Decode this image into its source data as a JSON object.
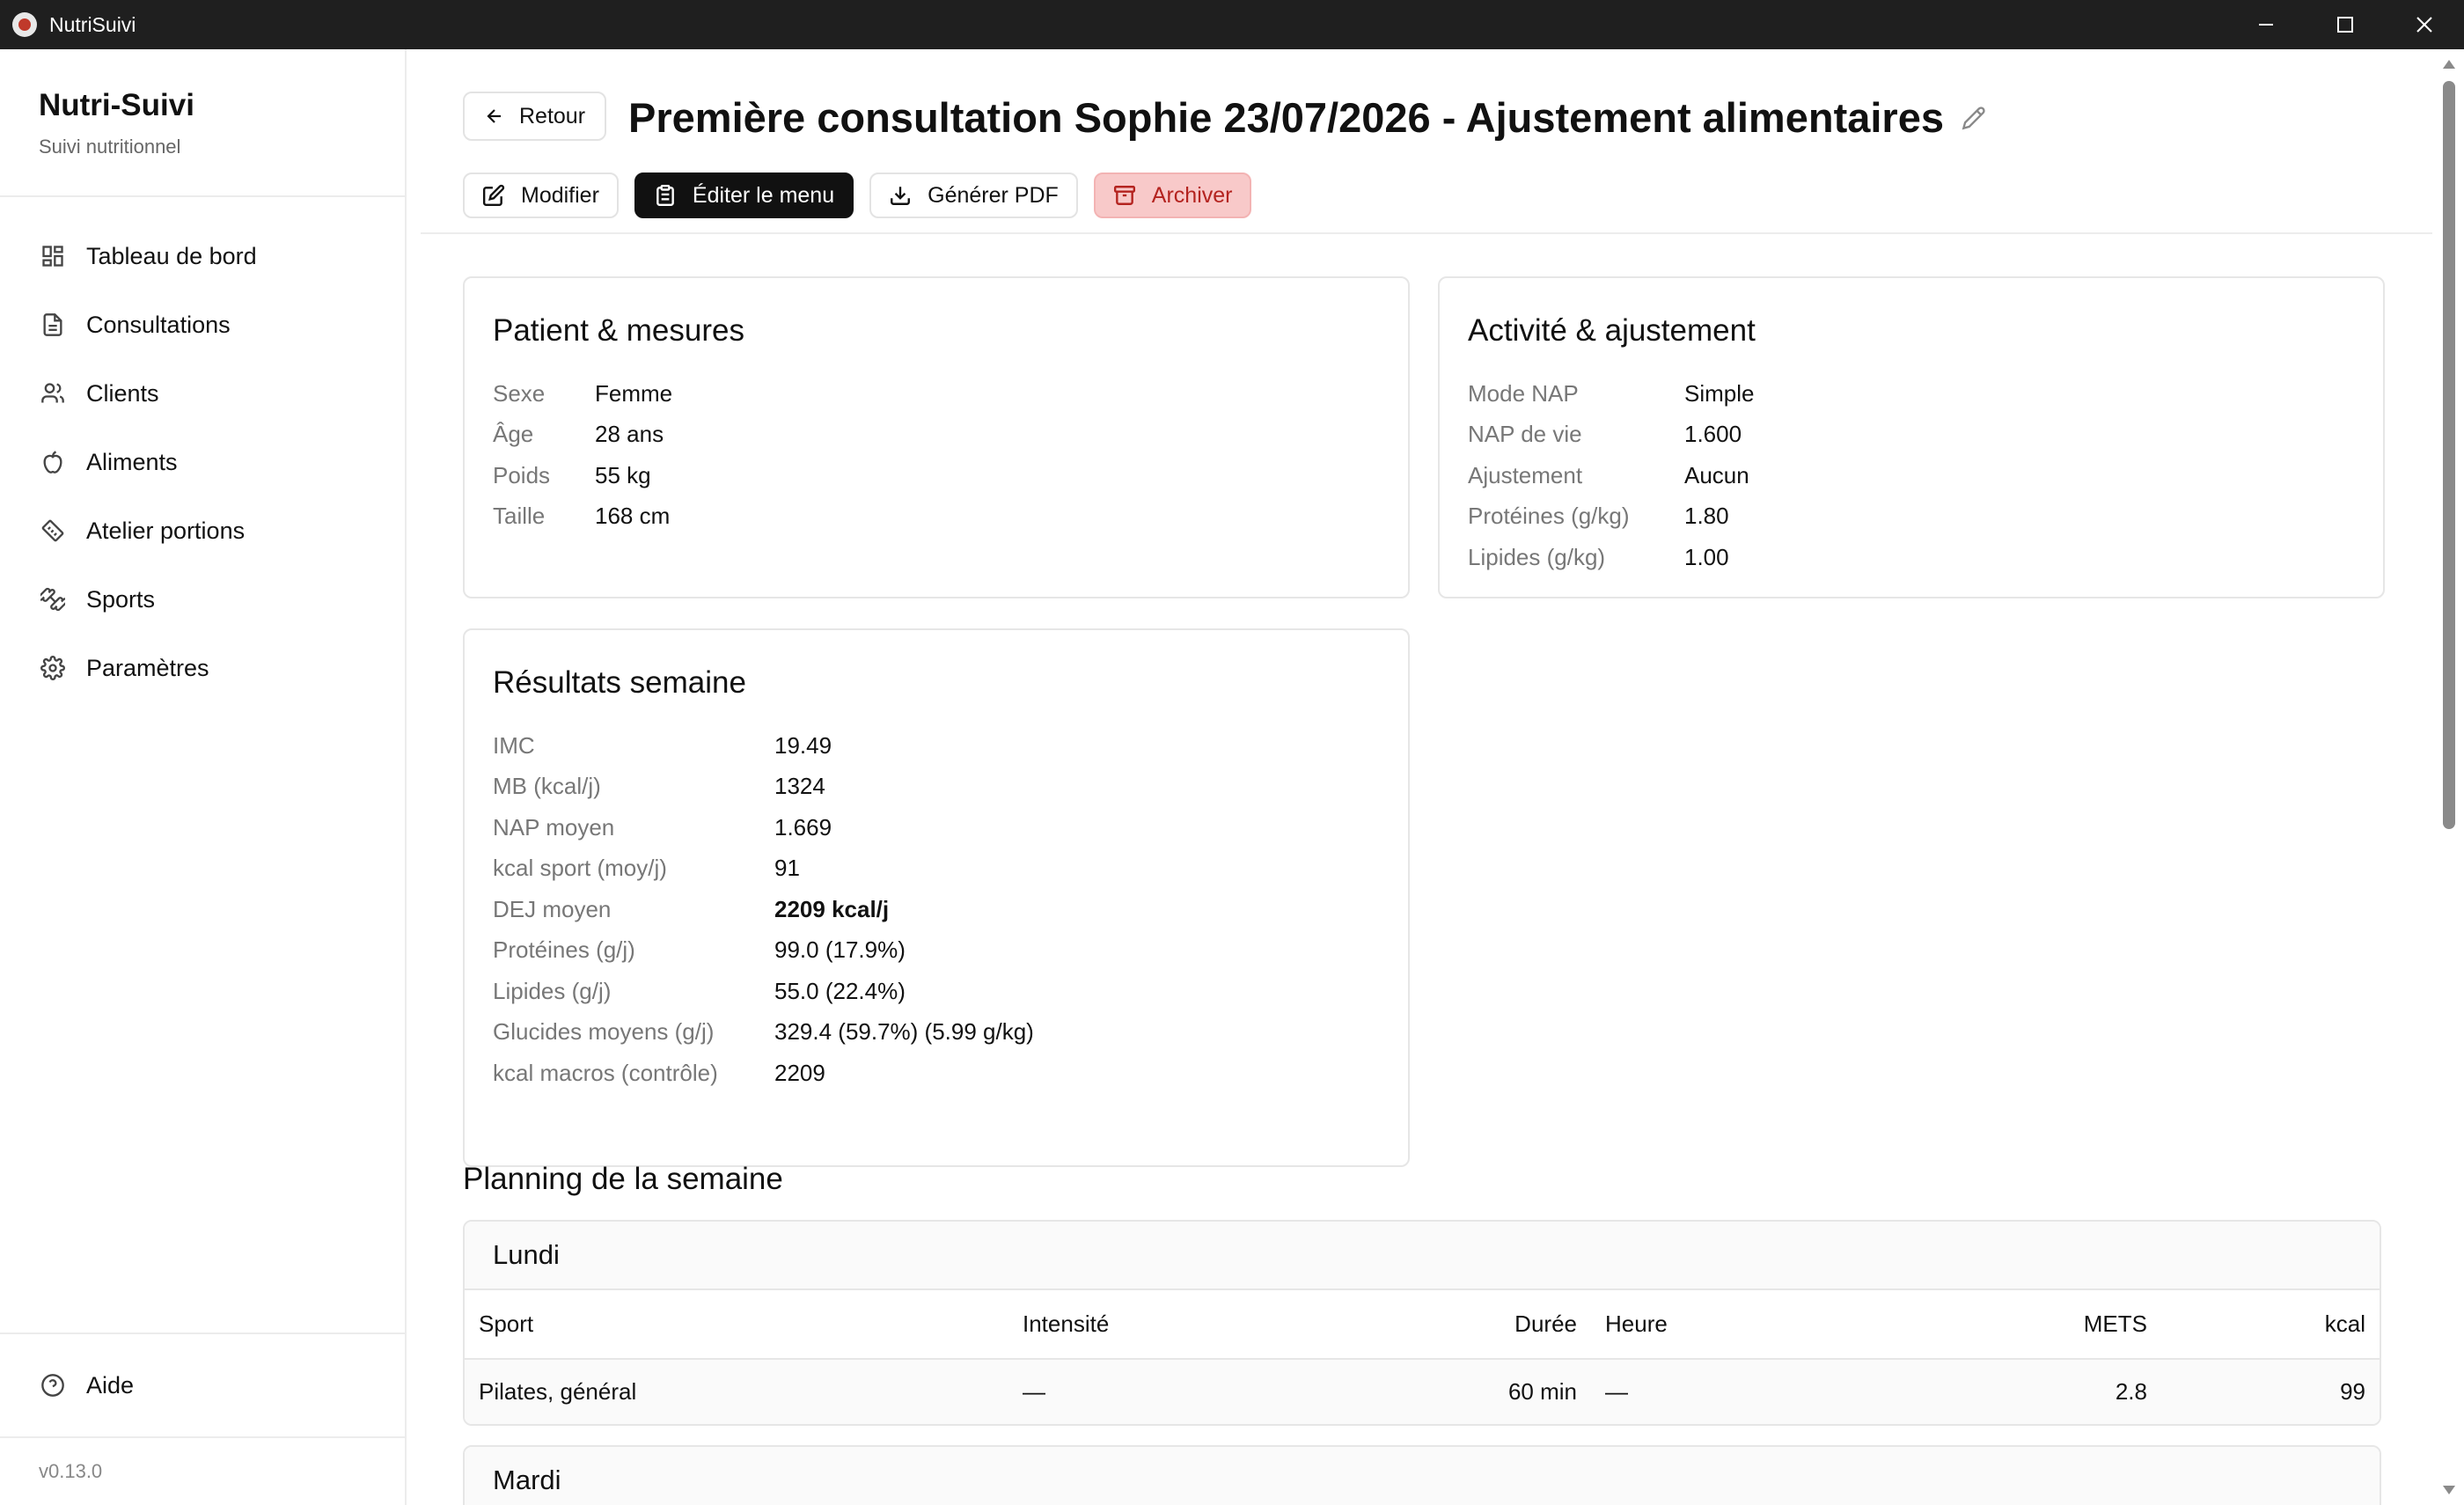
{
  "window": {
    "title": "NutriSuivi",
    "icons": {
      "minimize": "minimize-icon",
      "maximize": "maximize-icon",
      "close": "close-icon"
    }
  },
  "sidebar": {
    "brand_name": "Nutri-Suivi",
    "brand_sub": "Suivi nutritionnel",
    "items": [
      {
        "label": "Tableau de bord",
        "icon": "dashboard-icon"
      },
      {
        "label": "Consultations",
        "icon": "document-icon"
      },
      {
        "label": "Clients",
        "icon": "users-icon"
      },
      {
        "label": "Aliments",
        "icon": "apple-icon"
      },
      {
        "label": "Atelier portions",
        "icon": "ruler-icon"
      },
      {
        "label": "Sports",
        "icon": "dumbbell-icon"
      },
      {
        "label": "Paramètres",
        "icon": "gear-icon"
      }
    ],
    "help_label": "Aide",
    "version": "v0.13.0"
  },
  "header": {
    "back_label": "Retour",
    "title": "Première consultation Sophie 23/07/2026 - Ajustement alimentaires",
    "actions": {
      "edit": "Modifier",
      "edit_menu": "Éditer le menu",
      "pdf": "Générer PDF",
      "archive": "Archiver"
    }
  },
  "patient": {
    "title": "Patient & mesures",
    "rows": [
      {
        "k": "Sexe",
        "v": "Femme"
      },
      {
        "k": "Âge",
        "v": "28 ans"
      },
      {
        "k": "Poids",
        "v": "55 kg"
      },
      {
        "k": "Taille",
        "v": "168 cm"
      }
    ]
  },
  "activity": {
    "title": "Activité & ajustement",
    "rows": [
      {
        "k": "Mode NAP",
        "v": "Simple"
      },
      {
        "k": "NAP de vie",
        "v": "1.600"
      },
      {
        "k": "Ajustement",
        "v": "Aucun"
      },
      {
        "k": "Protéines (g/kg)",
        "v": "1.80"
      },
      {
        "k": "Lipides (g/kg)",
        "v": "1.00"
      }
    ]
  },
  "results": {
    "title": "Résultats semaine",
    "rows": [
      {
        "k": "IMC",
        "v": "19.49"
      },
      {
        "k": "MB (kcal/j)",
        "v": "1324"
      },
      {
        "k": "NAP moyen",
        "v": "1.669"
      },
      {
        "k": "kcal sport (moy/j)",
        "v": "91"
      },
      {
        "k": "DEJ moyen",
        "v": "2209 kcal/j"
      },
      {
        "k": "Protéines (g/j)",
        "v": "99.0 (17.9%)"
      },
      {
        "k": "Lipides (g/j)",
        "v": "55.0 (22.4%)"
      },
      {
        "k": "Glucides moyens (g/j)",
        "v": "329.4 (59.7%) (5.99 g/kg)"
      },
      {
        "k": "kcal macros (contrôle)",
        "v": "2209"
      }
    ]
  },
  "planning": {
    "title": "Planning de la semaine",
    "columns": {
      "sport": "Sport",
      "intensity": "Intensité",
      "duration": "Durée",
      "hour": "Heure",
      "mets": "METS",
      "kcal": "kcal"
    },
    "days": [
      {
        "name": "Lundi",
        "rows": [
          {
            "sport": "Pilates, général",
            "intensity": "—",
            "duration": "60 min",
            "hour": "—",
            "mets": "2.8",
            "kcal": "99"
          }
        ]
      },
      {
        "name": "Mardi"
      }
    ]
  }
}
